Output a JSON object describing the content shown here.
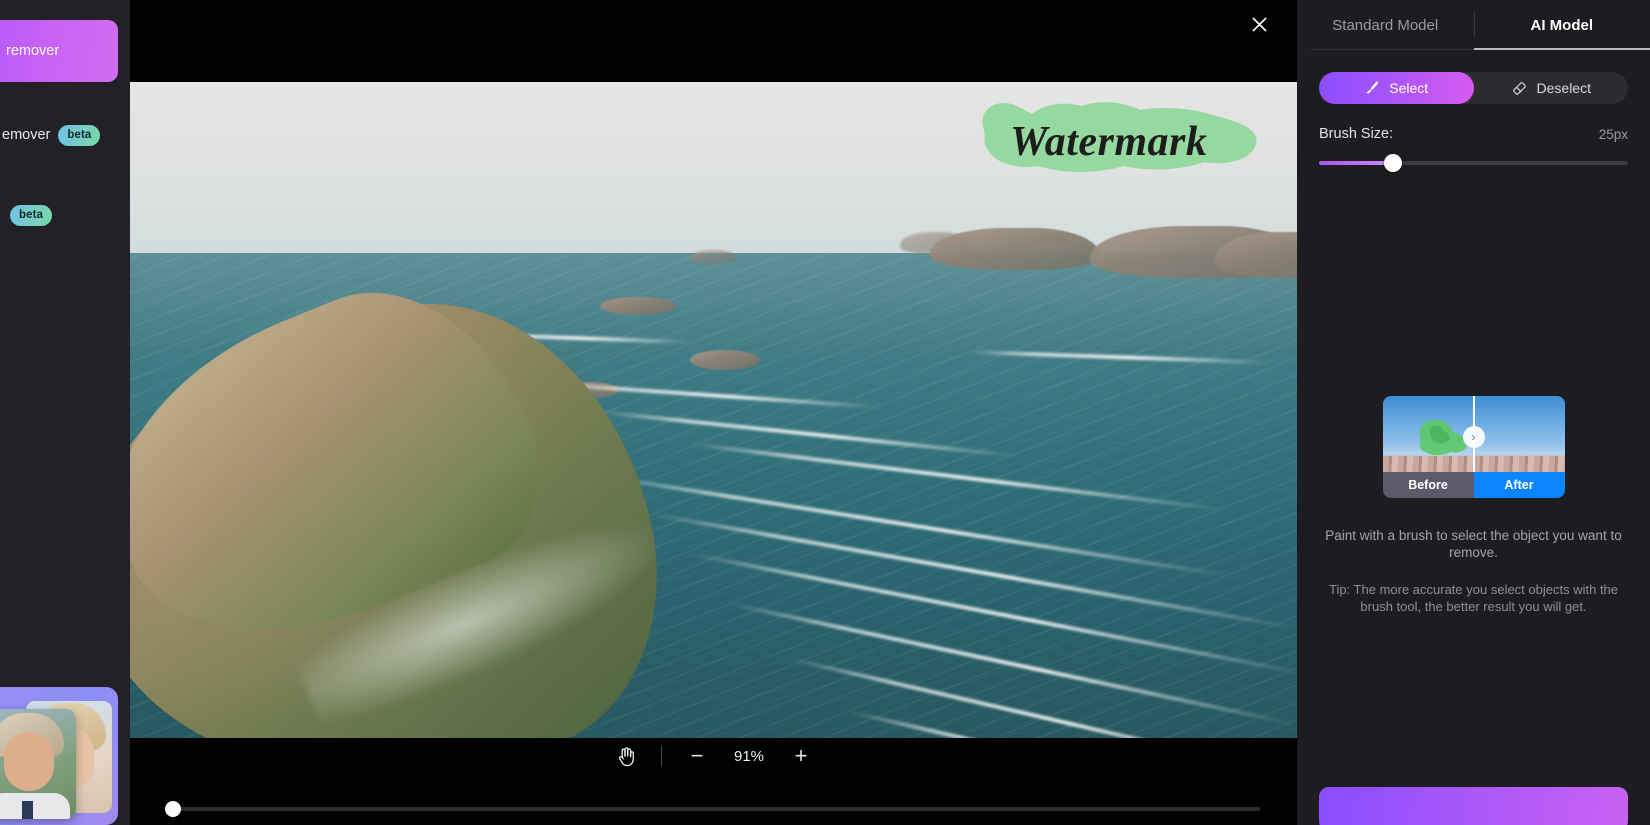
{
  "sidebar": {
    "promo_label": "remover",
    "items": [
      {
        "label": "emover",
        "badge": "beta"
      },
      {
        "label": "",
        "badge": "beta"
      }
    ]
  },
  "editor": {
    "close_icon": "close-icon",
    "watermark_text": "Watermark",
    "zoom": {
      "hand_icon": "hand-icon",
      "minus_label": "−",
      "value": "91%",
      "plus_label": "+"
    }
  },
  "panel": {
    "tabs": [
      {
        "label": "Standard Model",
        "active": false
      },
      {
        "label": "AI Model",
        "active": true
      }
    ],
    "tools": [
      {
        "label": "Select",
        "icon": "brush-icon",
        "active": true
      },
      {
        "label": "Deselect",
        "icon": "eraser-icon",
        "active": false
      }
    ],
    "brush": {
      "label": "Brush Size:",
      "value": "25px",
      "percent": 24
    },
    "preview": {
      "before_label": "Before",
      "after_label": "After",
      "chevron": "›"
    },
    "hint": "Paint with a brush to select the object you want to remove.",
    "tip": "Tip: The more accurate you select objects with the brush tool, the better result you will get."
  },
  "colors": {
    "accent_start": "#8a4dff",
    "accent_end": "#d959f0",
    "panel_bg": "#1d1d21",
    "canvas_bg": "#000000",
    "mask_green": "#8fd89a",
    "after_blue": "#0a84ff"
  }
}
